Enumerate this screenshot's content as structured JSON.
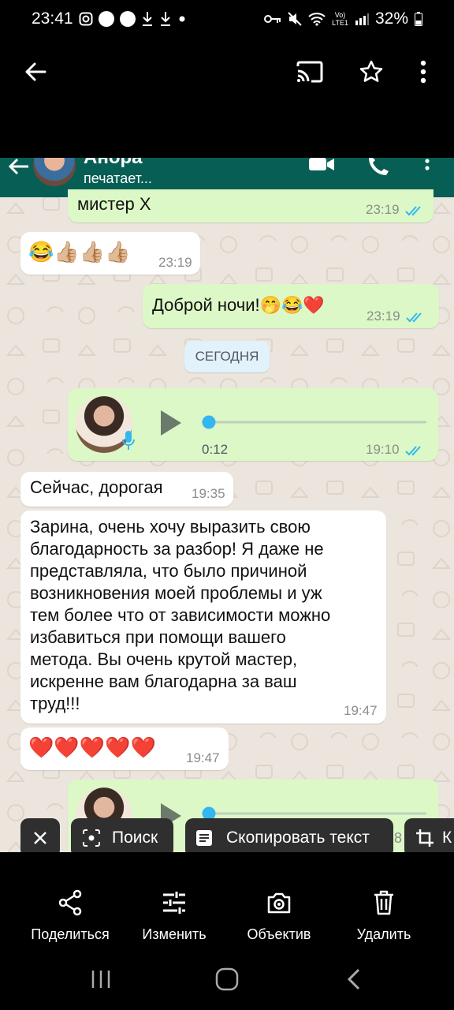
{
  "status_bar": {
    "time": "23:41",
    "battery": "32%",
    "network_label_top": "Vo)",
    "network_label_bottom": "LTE1"
  },
  "viewer": {
    "back_icon": "arrow-left-icon",
    "cast_icon": "cast-icon",
    "star_icon": "star-icon",
    "menu_icon": "more-vert-icon"
  },
  "chat": {
    "contact_name": "Анора",
    "contact_status": "печатает...",
    "messages": [
      {
        "dir": "out",
        "text": "мистер X",
        "time": "23:19"
      },
      {
        "dir": "in",
        "text": "😂👍🏼👍🏼👍🏼",
        "time": "23:19"
      },
      {
        "dir": "out",
        "text": "Доброй ночи!🤭😂❤️",
        "time": "23:19"
      },
      {
        "type": "date",
        "text": "СЕГОДНЯ"
      },
      {
        "dir": "out",
        "type": "voice",
        "duration": "0:12",
        "time": "19:10"
      },
      {
        "dir": "in",
        "text": "Сейчас, дорогая",
        "time": "19:35"
      },
      {
        "dir": "in",
        "lines": [
          "Зарина, очень хочу выразить свою",
          "благодарность за разбор! Я даже не",
          "представляла, что было причиной",
          "возникновения моей проблемы и уж",
          "тем более что от зависимости можно",
          "избавиться при помощи вашего",
          "метода. Вы очень крутой мастер,",
          "искренне вам благодарна за ваш",
          "труд!!!"
        ],
        "time": "19:47"
      },
      {
        "dir": "in",
        "text": "❤️❤️❤️❤️❤️",
        "time": "19:47"
      }
    ]
  },
  "lens_chips": {
    "search": "Поиск",
    "copy_text": "Скопировать текст",
    "partial_number": "8",
    "partial_k": "К"
  },
  "actions": {
    "share": "Поделиться",
    "edit": "Изменить",
    "lens": "Объектив",
    "delete": "Удалить"
  },
  "colors": {
    "wa_header": "#075e54",
    "bubble_out": "#dcf8c6",
    "bubble_in": "#ffffff",
    "chat_bg": "#ece5dd",
    "voice_accent": "#34b7f1",
    "tick_blue": "#34b7f1"
  }
}
